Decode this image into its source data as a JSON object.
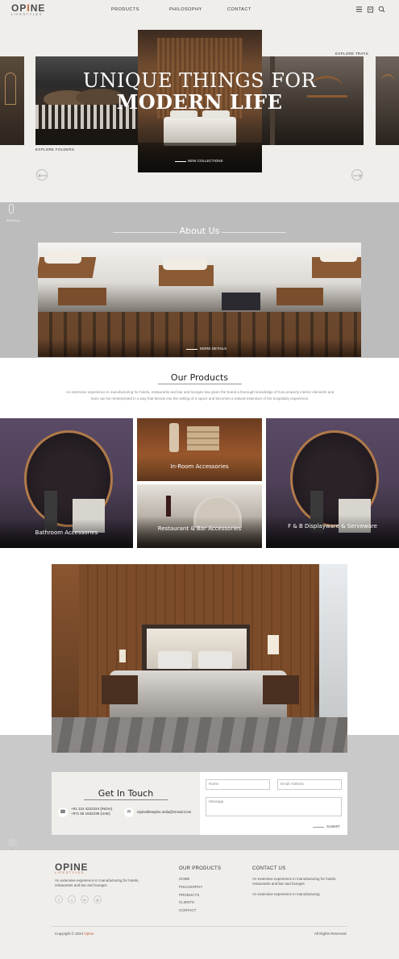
{
  "header": {
    "logo_main_a": "OP",
    "logo_main_i": "I",
    "logo_main_b": "NE",
    "logo_sub": "LIFESTYLES",
    "nav": [
      "PRODUCTS",
      "PHILOSOPHY",
      "CONTACT"
    ],
    "icons": [
      "menu-icon",
      "bag-icon",
      "search-icon"
    ]
  },
  "hero": {
    "title_line1": "UNIQUE THINGS FOR",
    "title_line2": "MODERN LIFE",
    "explore_trays": "EXPLORE TRAYS",
    "explore_folders": "EXPLORE FOLDERS",
    "new_collections": "NEW COLLECTIONS",
    "scroll": "SCROLL"
  },
  "about": {
    "title": "About Us",
    "more_details": "MORE DETAILS"
  },
  "products": {
    "title": "Our Products",
    "description": "An extensive experience in manufacturing for hotels, restaurants and bar and lounges has given the brand a thorough knowledge of how property interior elements and hues can be reinterpreted in a way that blends into the setting of a space and becomes a natural extension of the hospitality experience.",
    "items": [
      {
        "label": "Bathroom Accessories"
      },
      {
        "label": "In-Room Accessories"
      },
      {
        "label": "Restaurant & Bar Accessories"
      },
      {
        "label": "F & B Displayware & Serveware"
      }
    ]
  },
  "contact": {
    "title": "Get In Touch",
    "phone1": "+91 124 4222424 (INDIA)",
    "phone2": "+971 55 1532239 (UAE)",
    "email": "Opinelifestyles.India@Gmail.Com",
    "name_placeholder": "Name",
    "email_placeholder": "Email Address",
    "message_placeholder": "Message",
    "submit": "SUBMIT"
  },
  "footer": {
    "logo_main": "OPINE",
    "logo_sub": "LIFESTYLES",
    "about_text": "An extensive experience in manufacturing for hotels, restaurants and bar and lounges",
    "products_head": "OUR PRODUCTS",
    "links": [
      "HOME",
      "PHILOSOPHY",
      "PRODUCTS",
      "CLIENTS",
      "CONTACT"
    ],
    "contact_head": "CONTACT US",
    "contact_text1": "An extensive experience in manufacturing for hotels, restaurants and bar and lounges",
    "contact_text2": "An extensive experience in manufacturing",
    "copyright_prefix": "Copyright © 2024",
    "copyright_brand": "Opine",
    "rights": "All Rights Reserved",
    "socials": [
      "f",
      "t",
      "in",
      "yt"
    ]
  },
  "colors": {
    "accent": "#c0603a",
    "page_bg": "#efeeeb",
    "band_gray": "#bcbcbc",
    "purple_tile": "#5a4a66"
  }
}
